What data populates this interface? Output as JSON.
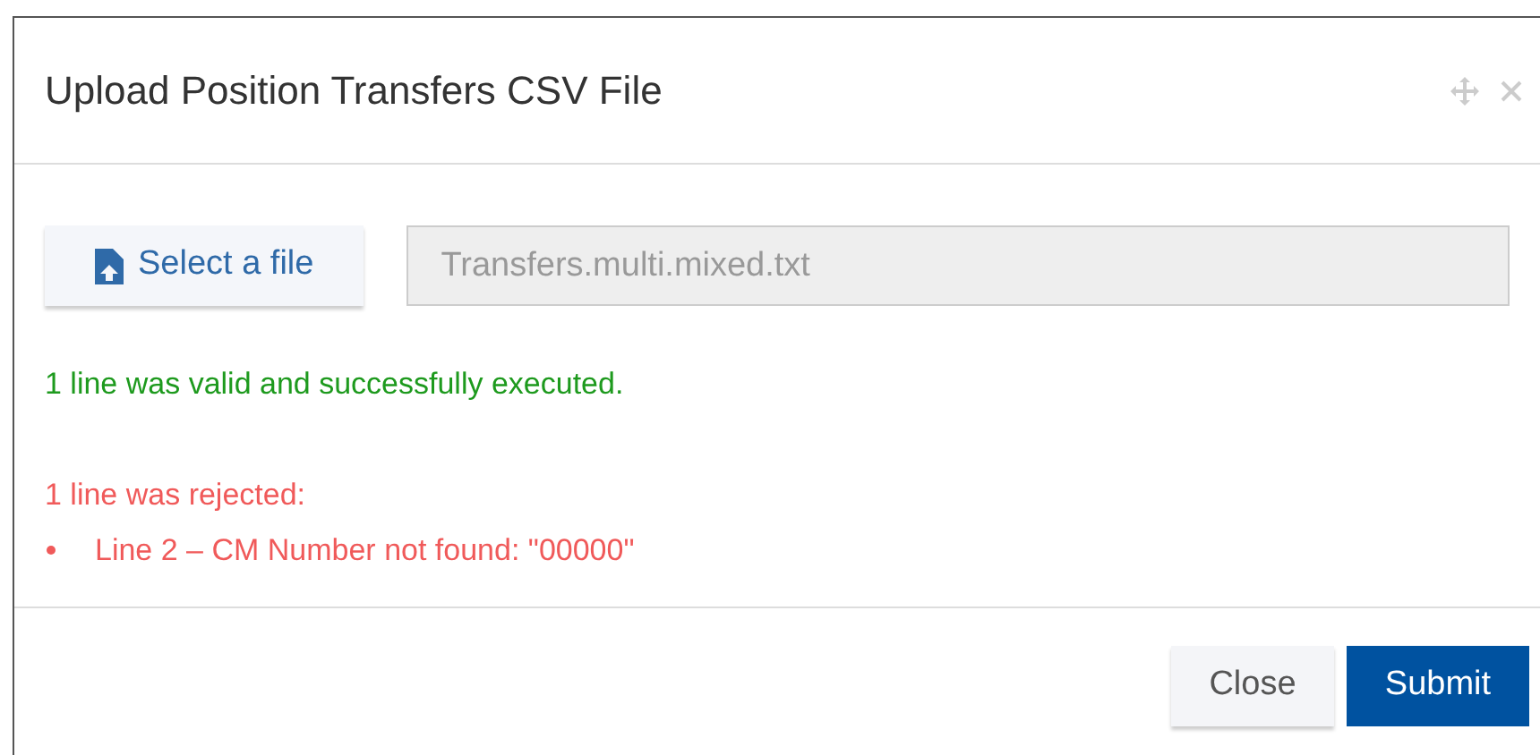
{
  "dialog": {
    "title": "Upload Position Transfers CSV File"
  },
  "file_picker": {
    "button": "Select a file",
    "value": "Transfers.multi.mixed.txt"
  },
  "messages": [
    {
      "kind": "success",
      "text": "1 line was valid and successfully executed."
    },
    {
      "kind": "error",
      "text": "1 line was rejected:",
      "items": [
        "Line 2 – CM Number not found: \"00000\""
      ]
    }
  ],
  "buttons": [
    {
      "kind": "secondary",
      "label": "Close"
    },
    {
      "kind": "primary",
      "label": "Submit"
    }
  ]
}
